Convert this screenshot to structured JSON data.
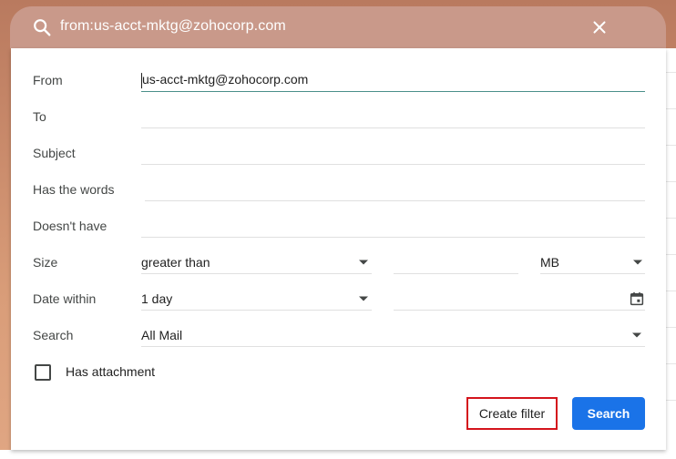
{
  "search": {
    "query": "from:us-acct-mktg@zohocorp.com"
  },
  "form": {
    "from_label": "From",
    "from_value": "us-acct-mktg@zohocorp.com",
    "to_label": "To",
    "to_value": "",
    "subject_label": "Subject",
    "subject_value": "",
    "has_words_label": "Has the words",
    "has_words_value": "",
    "doesnt_have_label": "Doesn't have",
    "doesnt_have_value": "",
    "size_label": "Size",
    "size_operator": "greater than",
    "size_value": "",
    "size_unit": "MB",
    "date_label": "Date within",
    "date_range": "1 day",
    "date_value": "",
    "search_in_label": "Search",
    "search_in_value": "All Mail",
    "has_attachment_label": "Has attachment",
    "has_attachment_checked": false
  },
  "buttons": {
    "create_filter": "Create filter",
    "search": "Search"
  },
  "colors": {
    "search_button": "#1a73e8",
    "highlight_border": "#d4141c"
  }
}
